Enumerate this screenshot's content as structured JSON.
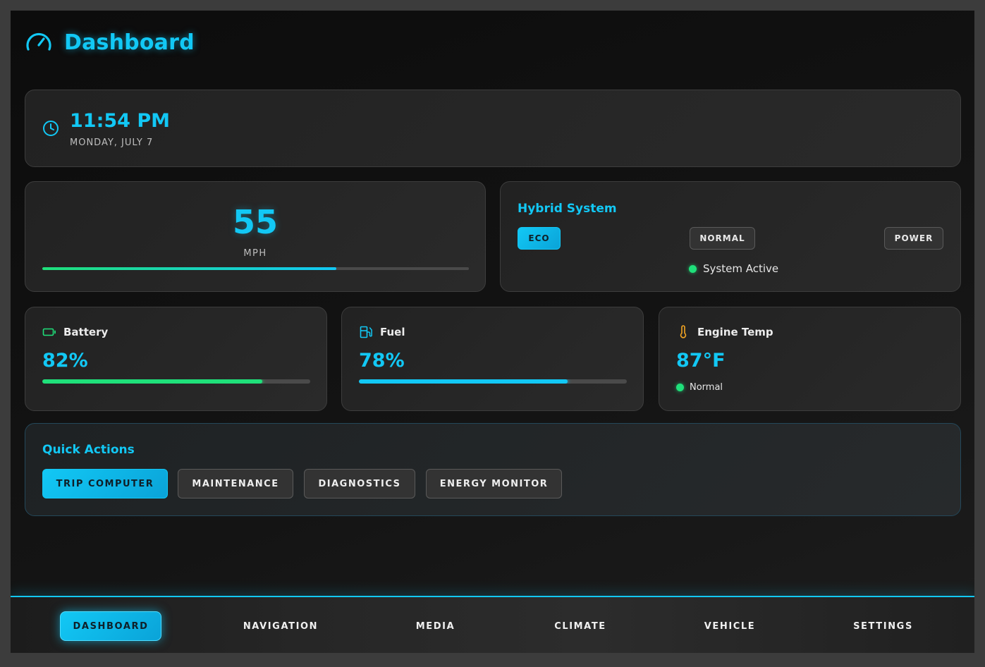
{
  "header": {
    "title": "Dashboard",
    "icon": "speedometer-icon"
  },
  "clock": {
    "time": "11:54 PM",
    "date": "MONDAY, JULY 7",
    "icon": "clock-icon"
  },
  "speed": {
    "value": "55",
    "unit": "MPH",
    "gauge_fraction": 0.69
  },
  "hybrid": {
    "title": "Hybrid System",
    "modes": [
      {
        "label": "ECO",
        "active": true
      },
      {
        "label": "NORMAL",
        "active": false
      },
      {
        "label": "POWER",
        "active": false
      }
    ],
    "status": "System Active"
  },
  "battery": {
    "label": "Battery",
    "value": "82%",
    "percent": 82,
    "icon": "battery-icon"
  },
  "fuel": {
    "label": "Fuel",
    "value": "78%",
    "percent": 78,
    "icon": "fuel-pump-icon"
  },
  "engine_temp": {
    "label": "Engine Temp",
    "value": "87°F",
    "status": "Normal",
    "icon": "thermometer-icon"
  },
  "quick_actions": {
    "title": "Quick Actions",
    "buttons": [
      {
        "label": "TRIP COMPUTER",
        "active": true
      },
      {
        "label": "MAINTENANCE",
        "active": false
      },
      {
        "label": "DIAGNOSTICS",
        "active": false
      },
      {
        "label": "ENERGY MONITOR",
        "active": false
      }
    ]
  },
  "nav": {
    "items": [
      {
        "label": "DASHBOARD",
        "active": true
      },
      {
        "label": "NAVIGATION",
        "active": false
      },
      {
        "label": "MEDIA",
        "active": false
      },
      {
        "label": "CLIMATE",
        "active": false
      },
      {
        "label": "VEHICLE",
        "active": false
      },
      {
        "label": "SETTINGS",
        "active": false
      }
    ]
  },
  "colors": {
    "accent": "#12c8f5",
    "success": "#1fe07a",
    "warning": "#f5a623"
  }
}
